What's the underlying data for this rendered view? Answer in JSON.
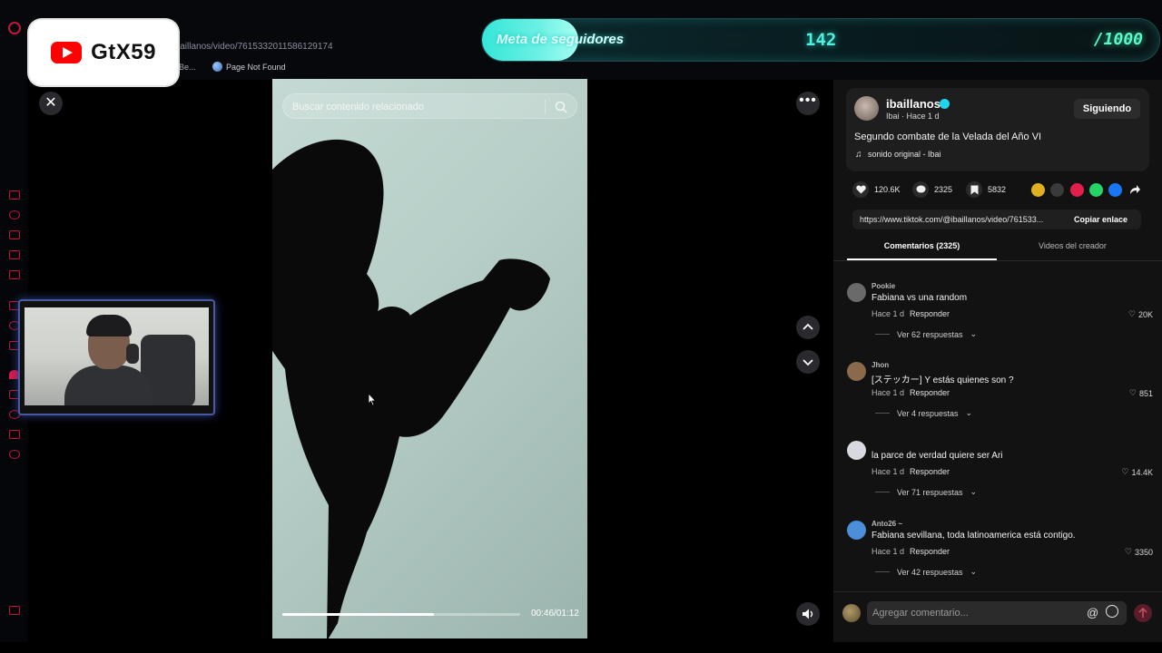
{
  "browser": {
    "url_fragment": "iaillanos/video/7615332011586129174",
    "bookmark_1": "s Be...",
    "bookmark_2": "Page Not Found"
  },
  "overlay": {
    "channel_name": "GtX59",
    "goal_label": "Meta de seguidores",
    "goal_current": "142",
    "goal_target": "/1000",
    "goal_progress_fraction": 0.142,
    "accent_color": "#35e6d8"
  },
  "video": {
    "search_placeholder": "Buscar contenido relacionado",
    "time": "00:46/01:12",
    "progress_fraction": 0.639
  },
  "post": {
    "author": "ibaillanos",
    "author_sub": "Ibai · Hace 1 d",
    "follow_label": "Siguiendo",
    "caption": "Segundo combate de la Velada del Año VI",
    "music": "sonido original - Ibai",
    "likes": "120.6K",
    "comments_count": "2325",
    "saves": "5832",
    "link": "https://www.tiktok.com/@ibaillanos/video/761533...",
    "copy_label": "Copiar enlace"
  },
  "tabs": {
    "comments": "Comentarios (2325)",
    "creator": "Videos del creador"
  },
  "comments": [
    {
      "user": "Pookie",
      "text": "Fabiana vs una random",
      "time": "Hace 1 d",
      "reply": "Responder",
      "likes": "20K",
      "replies": "Ver 62 respuestas",
      "avatar_color": "#6a6a6a"
    },
    {
      "user": "Jhon",
      "text": "[ステッカー] Y estás quienes son ?",
      "time": "Hace 1 d",
      "reply": "Responder",
      "likes": "851",
      "replies": "Ver 4 respuestas",
      "avatar_color": "#8a6a4a"
    },
    {
      "user": "",
      "text": "la parce de verdad quiere ser Ari",
      "time": "Hace 1 d",
      "reply": "Responder",
      "likes": "14.4K",
      "replies": "Ver 71 respuestas",
      "avatar_color": "#d8d8e0"
    },
    {
      "user": "Anto26 ~",
      "text": "Fabiana sevillana, toda latinoamerica está contigo.",
      "time": "Hace 1 d",
      "reply": "Responder",
      "likes": "3350",
      "replies": "Ver 42 respuestas",
      "avatar_color": "#4a8fd8"
    }
  ],
  "composer": {
    "placeholder": "Agregar comentario..."
  }
}
